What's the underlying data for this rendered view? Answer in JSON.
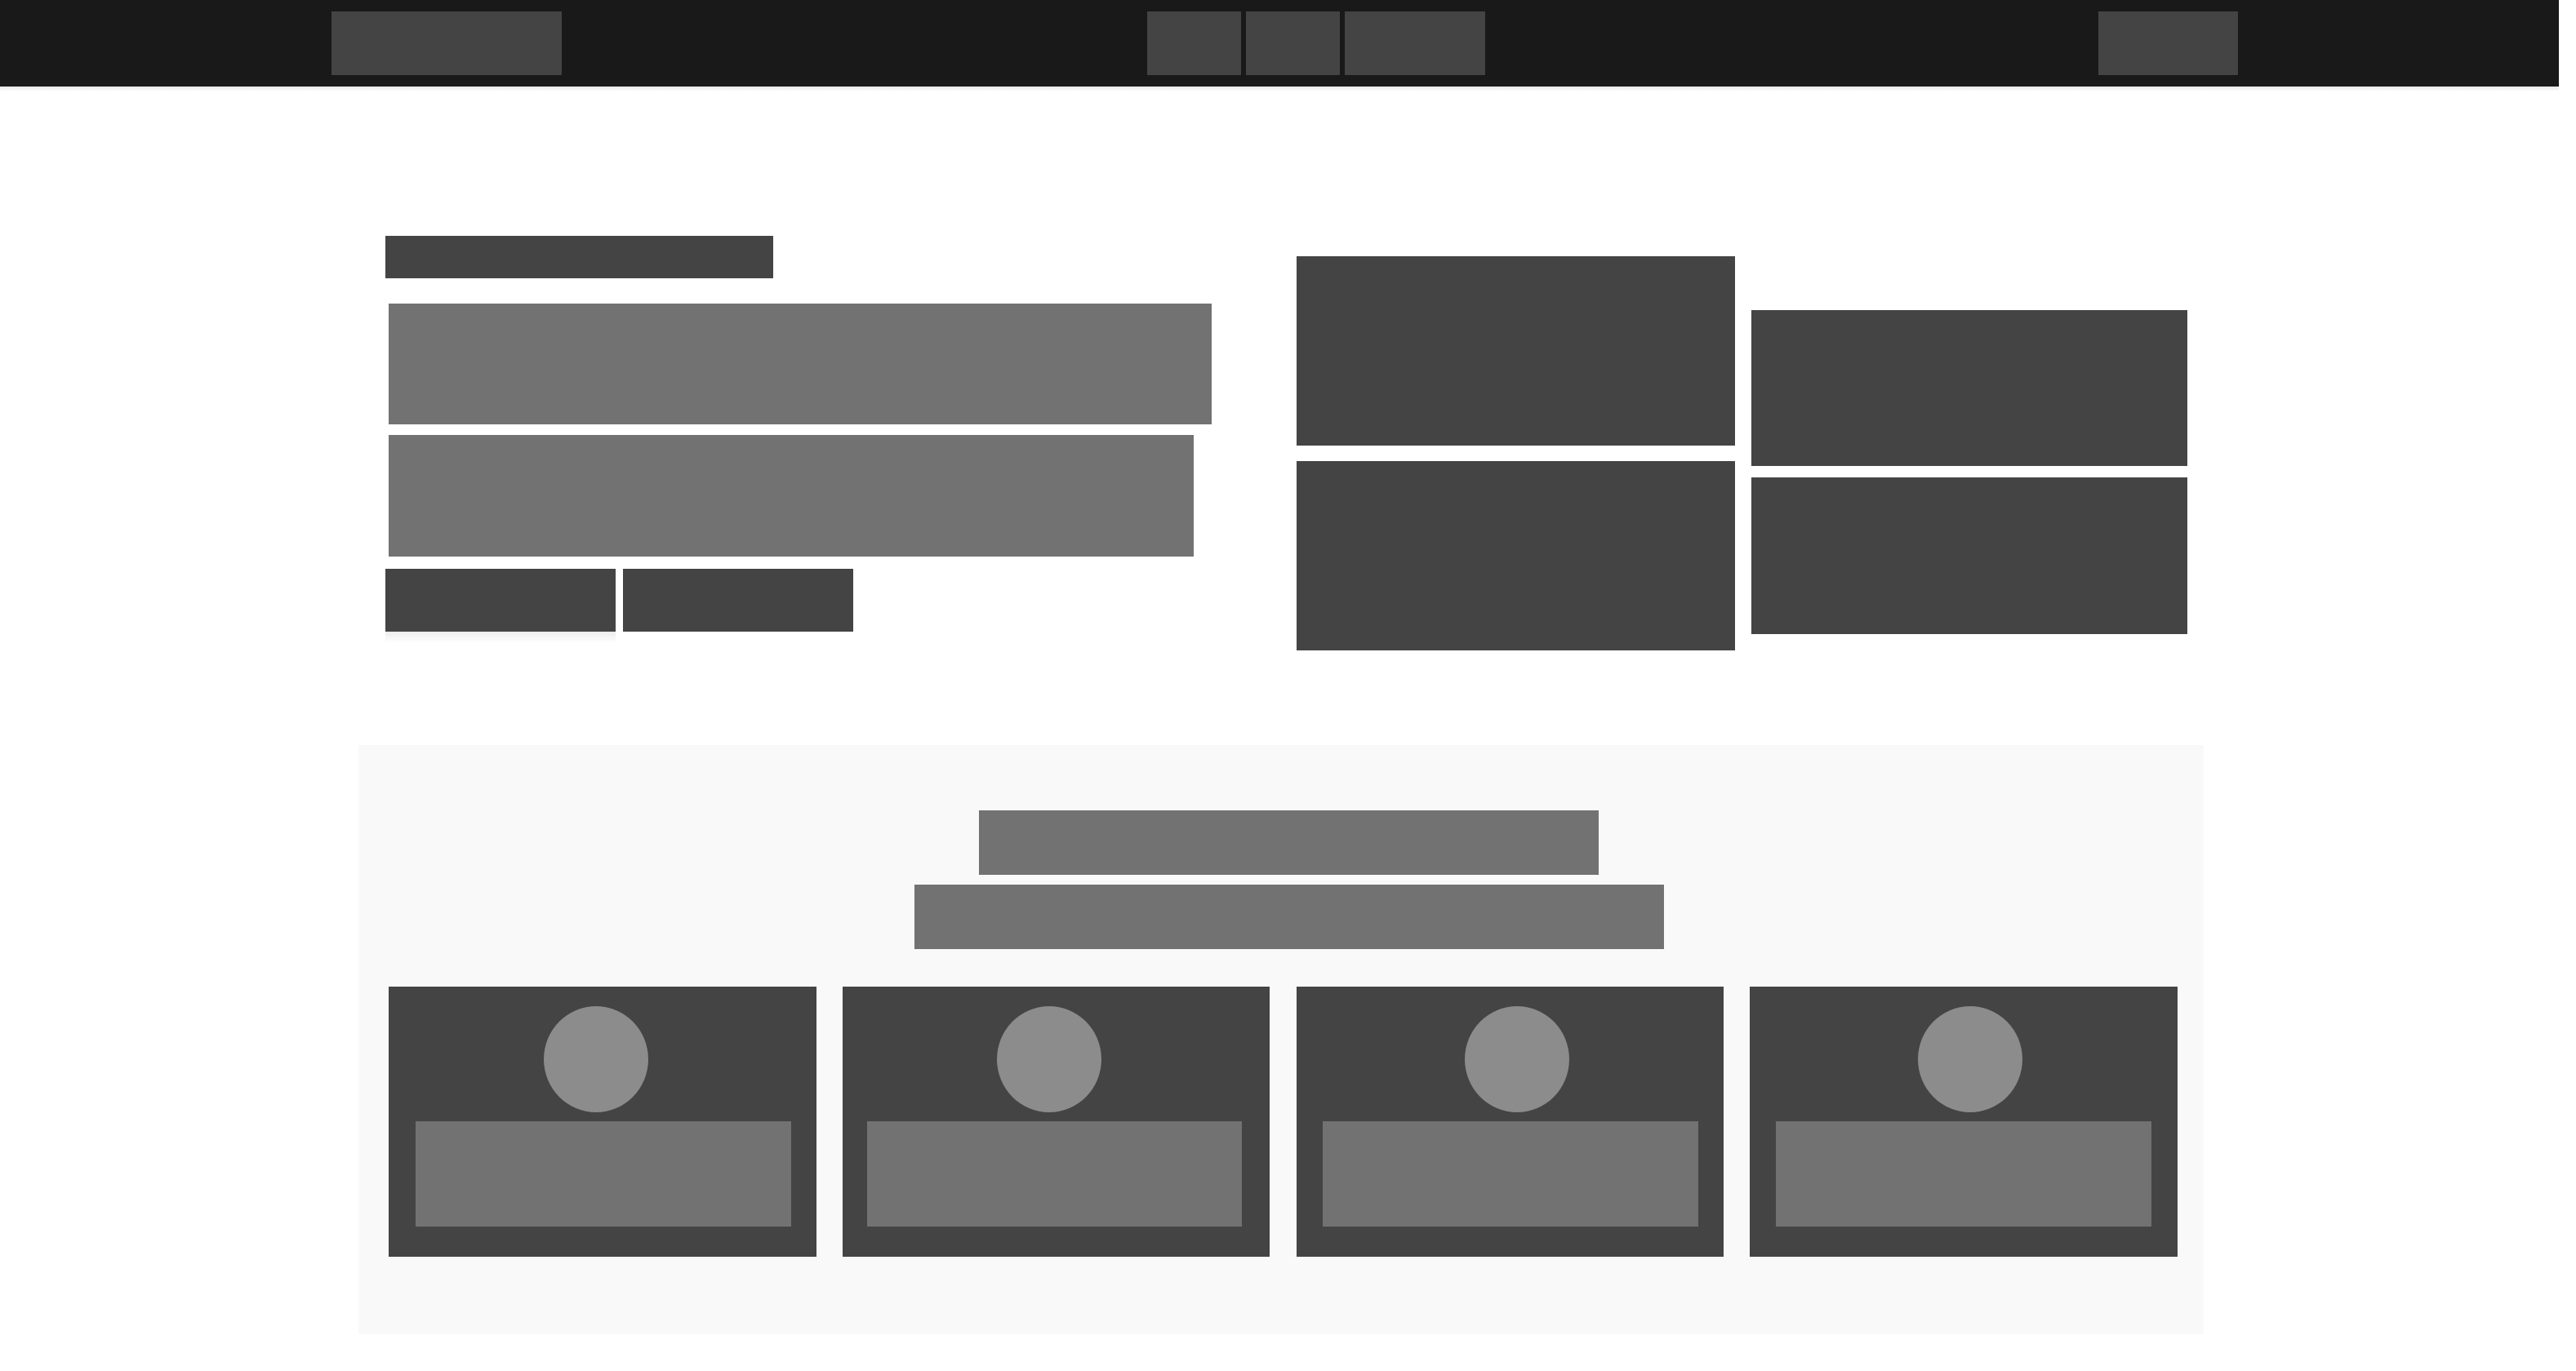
{
  "colors": {
    "topbar": "#191919",
    "block_dark": "#444444",
    "block_mid": "#727272",
    "avatar": "#8c8c8c",
    "section_bg": "#f9f9f9",
    "page_bg": "#ffffff"
  },
  "header": {
    "logo": "",
    "nav": [
      "",
      "",
      ""
    ],
    "action_button": ""
  },
  "hero": {
    "eyebrow": "",
    "headline_line_1": "",
    "headline_line_2": "",
    "primary_button": "",
    "secondary_button": "",
    "gallery": [
      "",
      "",
      "",
      ""
    ]
  },
  "features": {
    "title": "",
    "subtitle": "",
    "cards": [
      {
        "title": ""
      },
      {
        "title": ""
      },
      {
        "title": ""
      },
      {
        "title": ""
      }
    ]
  }
}
